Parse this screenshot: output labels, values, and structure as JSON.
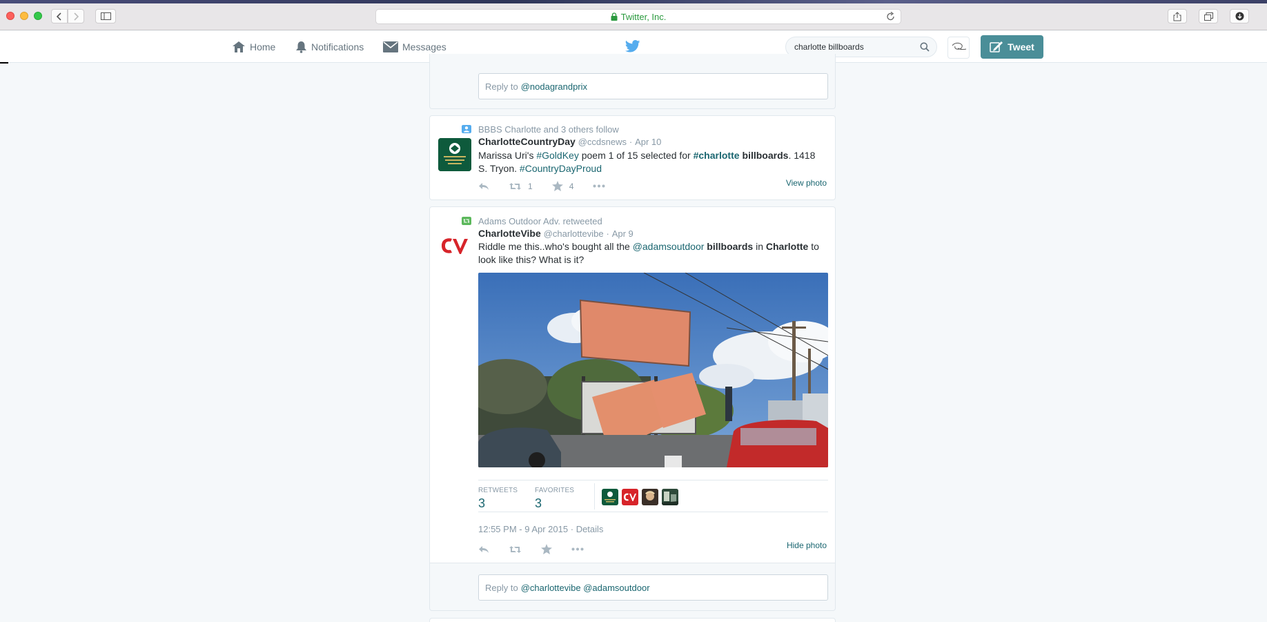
{
  "browser": {
    "url_text": "Twitter, Inc."
  },
  "nav": {
    "home": "Home",
    "notifications": "Notifications",
    "messages": "Messages",
    "search_value": "charlotte billboards",
    "tweet_button": "Tweet"
  },
  "reply_top": {
    "prefix": "Reply to",
    "mention": "@nodagrandprix"
  },
  "tweet1": {
    "context": "BBBS Charlotte and 3 others follow",
    "name": "CharlotteCountryDay",
    "handle": "@ccdsnews",
    "sep": "·",
    "time": "Apr 10",
    "text_1": "Marissa Uri's",
    "tag_1": "#GoldKey",
    "text_2": "poem 1 of 15 selected for",
    "tag_2": "#charlotte",
    "bold_1": "billboards",
    "text_3": ". 1418 S. Tryon.",
    "tag_3": "#CountryDayProud",
    "retweets": "1",
    "favorites": "4",
    "view_photo": "View photo"
  },
  "tweet2": {
    "context": "Adams Outdoor Adv. retweeted",
    "name": "CharlotteVibe",
    "handle": "@charlottevibe",
    "sep": "·",
    "time": "Apr 9",
    "text_1": "Riddle me this..who's bought all the",
    "mention_1": "@adamsoutdoor",
    "bold_1": "billboards",
    "text_2": "in",
    "bold_2": "Charlotte",
    "text_3": "to look like this? What is it?",
    "retweets_label": "RETWEETS",
    "retweets_value": "3",
    "favorites_label": "FAVORITES",
    "favorites_value": "3",
    "timestamp": "12:55 PM - 9 Apr 2015",
    "details_sep": "·",
    "details": "Details",
    "hide_photo": "Hide photo"
  },
  "reply_bottom": {
    "prefix": "Reply to",
    "mention": "@charlottevibe @adamsoutdoor"
  },
  "colors": {
    "accent": "#1a6670",
    "tweet_button": "#4a8e98",
    "twitter_blue": "#55acee"
  }
}
